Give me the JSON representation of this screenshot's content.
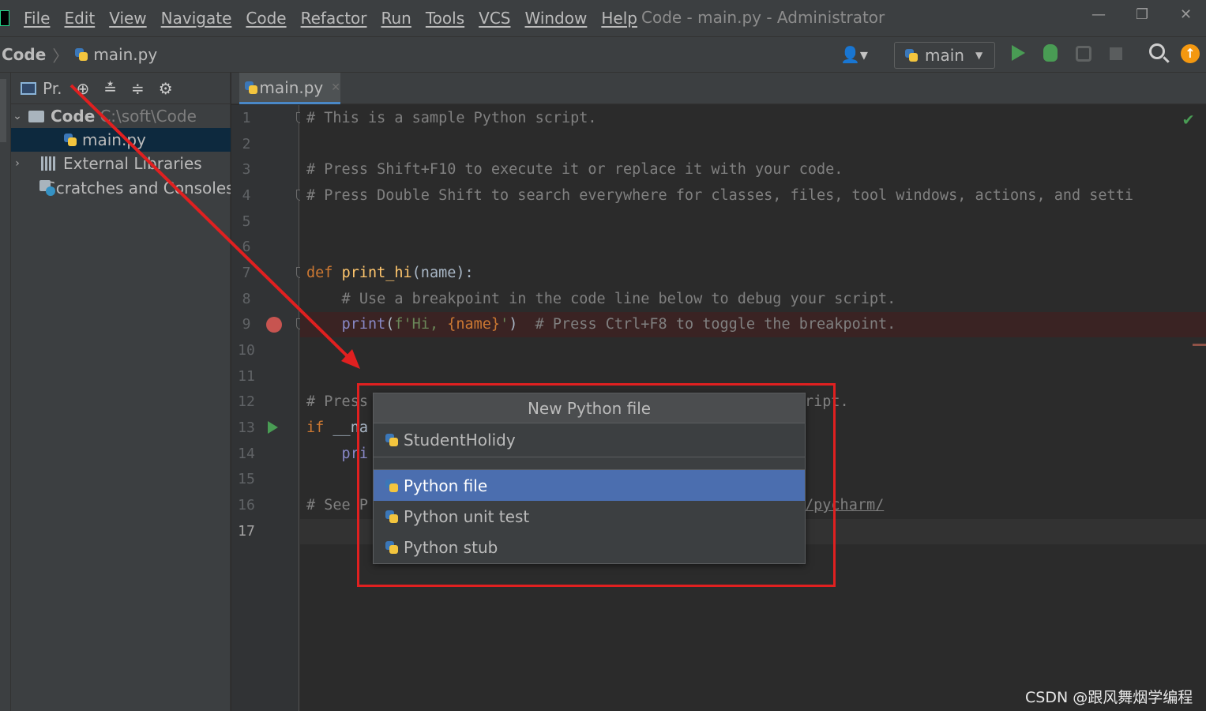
{
  "menu": {
    "items": [
      "File",
      "Edit",
      "View",
      "Navigate",
      "Code",
      "Refactor",
      "Run",
      "Tools",
      "VCS",
      "Window",
      "Help"
    ],
    "window_title": "Code - main.py - Administrator",
    "minimize": "—",
    "restore": "❐",
    "close": "✕"
  },
  "navbar": {
    "root": "Code",
    "file": "main.py",
    "run_config": "main",
    "update_badge": "↑"
  },
  "project_panel": {
    "title": "Pr.",
    "tree": {
      "root_label": "Code",
      "root_path": "C:\\soft\\Code",
      "file_label": "main.py",
      "libraries_label": "External Libraries",
      "scratches_label": "Scratches and Consoles"
    }
  },
  "editor": {
    "tab_label": "main.py",
    "line_numbers": [
      "1",
      "2",
      "3",
      "4",
      "5",
      "6",
      "7",
      "8",
      "9",
      "10",
      "11",
      "12",
      "13",
      "14",
      "15",
      "16",
      "17"
    ],
    "lines": {
      "l1": "# This is a sample Python script.",
      "l3": "# Press Shift+F10 to execute it or replace it with your code.",
      "l4": "# Press Double Shift to search everywhere for classes, files, tool windows, actions, and setti",
      "l7_def": "def ",
      "l7_fn": "print_hi",
      "l7_rest": "(name):",
      "l8": "    # Use a breakpoint in the code line below to debug your script.",
      "l9_indent": "    ",
      "l9_print": "print",
      "l9_open": "(",
      "l9_str1": "f'Hi, ",
      "l9_param": "{name}",
      "l9_str2": "'",
      "l9_close": ")",
      "l9_comment": "  # Press Ctrl+F8 to toggle the breakpoint.",
      "l12_left": "# Press",
      "l12_right": "ript.",
      "l13_kw": "if",
      "l13_rest": " __na",
      "l14": "    pri",
      "l16_left": "# See P",
      "l16_right": "/pycharm/"
    }
  },
  "popup": {
    "title": "New Python file",
    "name_value": "StudentHolidy",
    "options": [
      "Python file",
      "Python unit test",
      "Python stub"
    ],
    "selected_index": 0
  },
  "colors": {
    "accent": "#4b6eaf",
    "annotation": "#e02020",
    "breakpoint": "#c75450",
    "run": "#499c54"
  },
  "watermark": "CSDN @跟风舞烟学编程"
}
